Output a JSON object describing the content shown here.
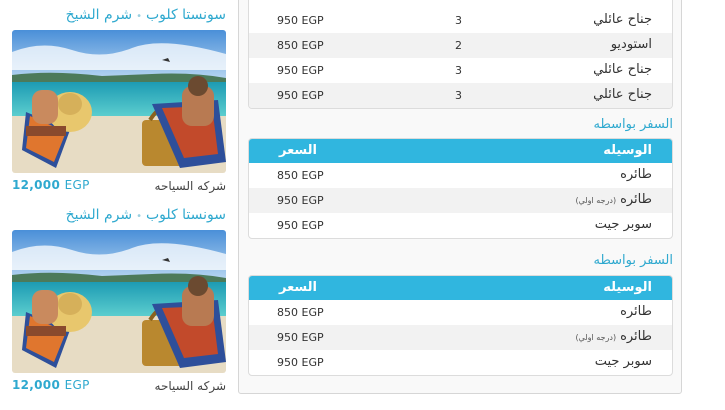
{
  "offers": [
    {
      "title_destination": "شرم الشيخ",
      "title_hotel": "سونستا كلوب",
      "separator": "•",
      "price_amount": "12,000",
      "price_currency": "EGP",
      "company": "شركه السياحه"
    },
    {
      "title_destination": "شرم الشيخ",
      "title_hotel": "سونستا كلوب",
      "separator": "•",
      "price_amount": "12,000",
      "price_currency": "EGP",
      "company": "شركه السياحه"
    }
  ],
  "rooms": [
    {
      "type": "جناح عائلي",
      "count": "3",
      "price": "950 EGP"
    },
    {
      "type": "استوديو",
      "count": "2",
      "price": "850 EGP"
    },
    {
      "type": "جناح عائلي",
      "count": "3",
      "price": "950 EGP"
    },
    {
      "type": "جناح عائلي",
      "count": "3",
      "price": "950 EGP"
    }
  ],
  "transport_sections": [
    {
      "title": "السفر بواسطه",
      "header_method": "الوسيله",
      "header_price": "السعر",
      "rows": [
        {
          "method": "طائره",
          "note": "",
          "price": "850 EGP"
        },
        {
          "method": "طائره",
          "note": "(درجه اولي)",
          "price": "950 EGP"
        },
        {
          "method": "سوبر جيت",
          "note": "",
          "price": "950 EGP"
        }
      ]
    },
    {
      "title": "السفر بواسطه",
      "header_method": "الوسيله",
      "header_price": "السعر",
      "rows": [
        {
          "method": "طائره",
          "note": "",
          "price": "850 EGP"
        },
        {
          "method": "طائره",
          "note": "(درجه اولي)",
          "price": "950 EGP"
        },
        {
          "method": "سوبر جيت",
          "note": "",
          "price": "950 EGP"
        }
      ]
    }
  ],
  "colors": {
    "accent": "#2fa9cf",
    "header_bg": "#30b6df",
    "alt_row": "#f2f2f2"
  }
}
